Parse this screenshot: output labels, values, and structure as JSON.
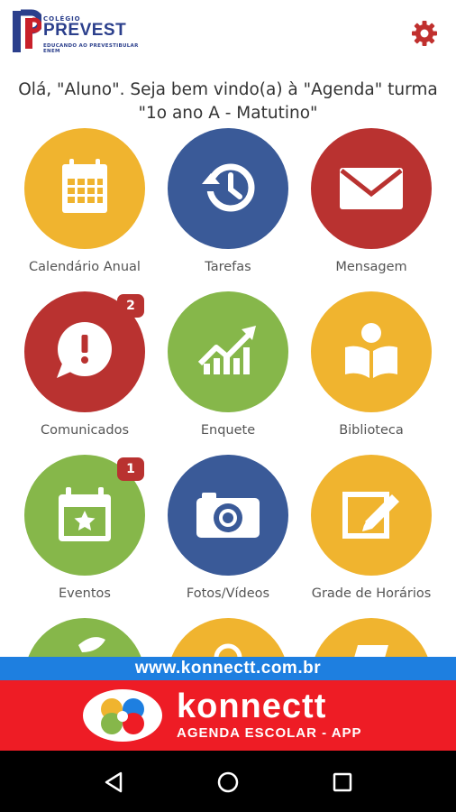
{
  "header": {
    "logo_small": "COLÉGIO",
    "logo_big": "PREVEST",
    "logo_tag": "EDUCANDO AO PREVESTIBULAR ENEM",
    "settings_icon": "gear-icon"
  },
  "welcome": "Olá, \"Aluno\". Seja bem vindo(a) à \"Agenda\" turma \"1o ano A - Matutino\"",
  "tiles": [
    {
      "label": "Calendário Anual",
      "icon": "calendar-icon",
      "color": "#f0b42f"
    },
    {
      "label": "Tarefas",
      "icon": "history-icon",
      "color": "#3a5a98"
    },
    {
      "label": "Mensagem",
      "icon": "envelope-icon",
      "color": "#b93230"
    },
    {
      "label": "Comunicados",
      "icon": "alert-bubble-icon",
      "color": "#b93230",
      "badge": "2"
    },
    {
      "label": "Enquete",
      "icon": "chart-icon",
      "color": "#86b74a"
    },
    {
      "label": "Biblioteca",
      "icon": "reader-icon",
      "color": "#f0b42f"
    },
    {
      "label": "Eventos",
      "icon": "event-calendar-icon",
      "color": "#86b74a",
      "badge": "1"
    },
    {
      "label": "Fotos/Vídeos",
      "icon": "camera-icon",
      "color": "#3a5a98"
    },
    {
      "label": "Grade de Horários",
      "icon": "edit-icon",
      "color": "#f0b42f"
    },
    {
      "label": "",
      "icon": "leaf-icon",
      "color": "#86b74a"
    },
    {
      "label": "",
      "icon": "circle-icon",
      "color": "#f0b42f"
    },
    {
      "label": "",
      "icon": "ticket-icon",
      "color": "#f0b42f"
    }
  ],
  "banner": {
    "url": "www.konnectt.com.br",
    "name": "konnectt",
    "tagline": "AGENDA ESCOLAR - APP"
  },
  "navbar": {
    "back_icon": "back-triangle-icon",
    "home_icon": "home-circle-icon",
    "recents_icon": "recents-square-icon"
  }
}
